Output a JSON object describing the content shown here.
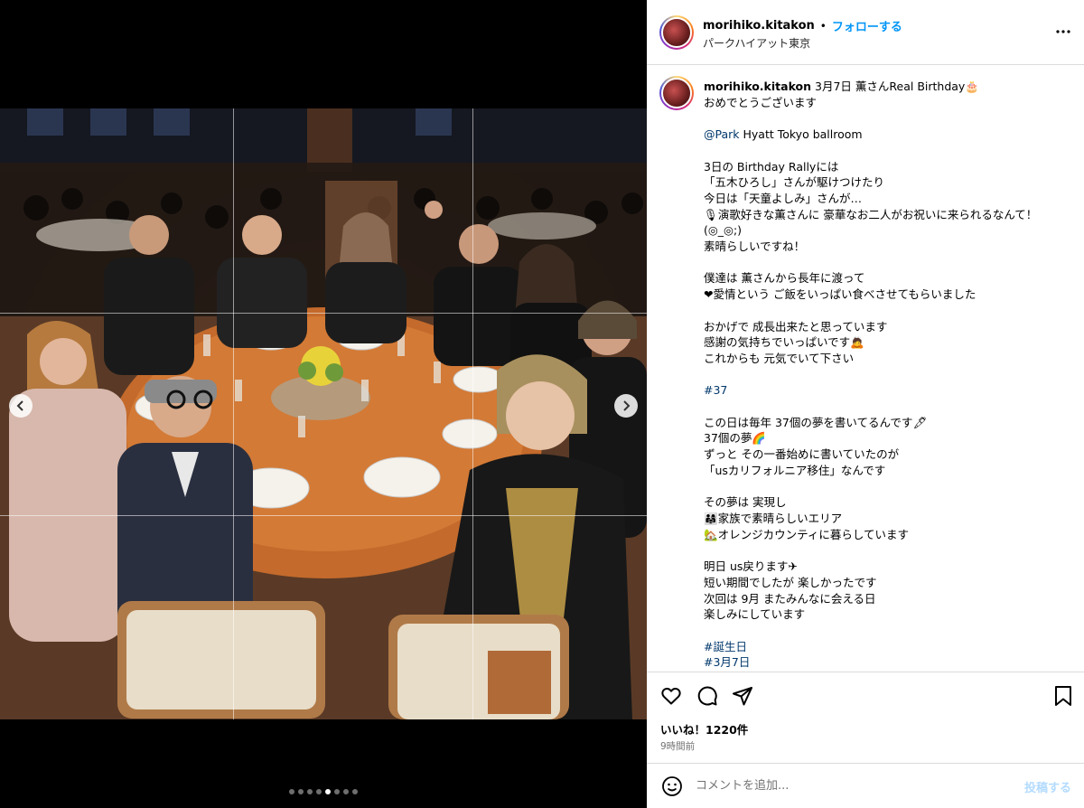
{
  "post": {
    "username": "morihiko.kitakon",
    "follow_label": "フォローする",
    "separator": "•",
    "location": "パークハイアット東京",
    "date": "3月7日",
    "caption_first": "薫さんReal Birthday🎂",
    "caption_lines": [
      "おめでとうございます",
      "",
      "",
      "3日の Birthday Rallyには",
      "「五木ひろし」さんが駆けつけたり",
      "今日は「天童よしみ」さんが…",
      "🎙演歌好きな薫さんに 豪華なお二人がお祝いに来られるなんて！(◎_◎;)",
      "素晴らしいですね！",
      "",
      "僕達は 薫さんから長年に渡って",
      "❤愛情という ご飯をいっぱい食べさせてもらいました",
      "",
      "おかげで 成長出来たと思っています",
      "感謝の気持ちでいっぱいです🙇",
      "これからも 元気でいて下さい",
      "",
      "",
      "",
      "この日は毎年 37個の夢を書いてるんです🖋",
      "37個の夢🌈",
      "ずっと その一番始めに書いていたのが",
      "「usカリフォルニア移住」なんです",
      "",
      "その夢は 実現し",
      "👨‍👩‍👧家族で素晴らしいエリア",
      "🏡オレンジカウンティに暮らしています",
      "",
      "明日 us戻ります✈",
      "短い期間でしたが 楽しかったです",
      "次回は 9月 またみんなに会える日",
      "楽しみにしています"
    ],
    "mention": "@Park",
    "mention_rest": " Hyatt Tokyo ballroom",
    "hashtag_37": "#37",
    "hashtags_end": [
      "#誕生日",
      "#3月7日"
    ],
    "likes": "いいね！1220件",
    "time_ago": "9時間前",
    "comment_placeholder": "コメントを追加...",
    "post_label": "投稿する"
  },
  "icons": [
    "more-icon",
    "heart-icon",
    "comment-icon",
    "share-icon",
    "bookmark-icon",
    "emoji-icon",
    "prev-arrow-icon",
    "next-arrow-icon"
  ],
  "carousel": {
    "total": 8,
    "active": 4
  },
  "colors": {
    "link": "#00376b",
    "follow": "#0095f6",
    "muted": "#737373",
    "post_disabled": "#b3dbff"
  }
}
